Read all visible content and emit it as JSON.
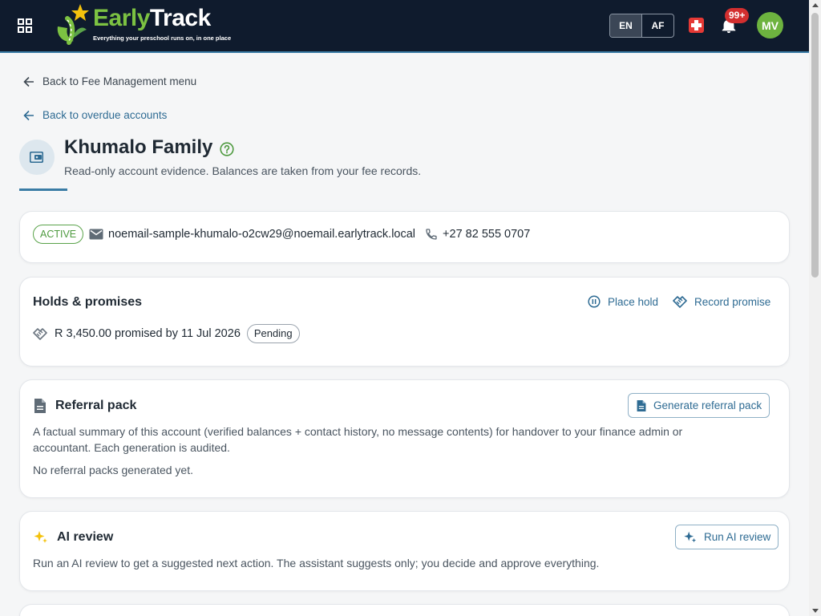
{
  "header": {
    "logo_word_a": "Early",
    "logo_word_b": "Track",
    "logo_tagline": "Everything your preschool runs on, in one place",
    "lang_en": "EN",
    "lang_af": "AF",
    "notification_count": "99+",
    "avatar_initials": "MV",
    "colors": {
      "bar": "#0f1b2d",
      "brand_green": "#7cc242",
      "accent": "#3a7ca5"
    }
  },
  "nav": {
    "back_menu": "Back to Fee Management menu",
    "back_overdue": "Back to overdue accounts"
  },
  "page": {
    "title": "Khumalo Family",
    "subtitle": "Read-only account evidence. Balances are taken from your fee records."
  },
  "contact": {
    "status": "ACTIVE",
    "email": "noemail-sample-khumalo-o2cw29@noemail.earlytrack.local",
    "phone": "+27 82 555 0707"
  },
  "holds": {
    "title": "Holds & promises",
    "place_hold": "Place hold",
    "record_promise": "Record promise",
    "promise_text": "R 3,450.00 promised by 11 Jul 2026",
    "promise_status": "Pending"
  },
  "referral": {
    "title": "Referral pack",
    "button": "Generate referral pack",
    "description_line1": "A factual summary of this account (verified balances + contact history, no message contents) for handover to your finance admin or",
    "description_line2": "accountant. Each generation is audited.",
    "empty": "No referral packs generated yet."
  },
  "ai": {
    "title": "AI review",
    "button": "Run AI review",
    "description": "Run an AI review to get a suggested next action. The assistant suggests only; you decide and approve everything."
  }
}
